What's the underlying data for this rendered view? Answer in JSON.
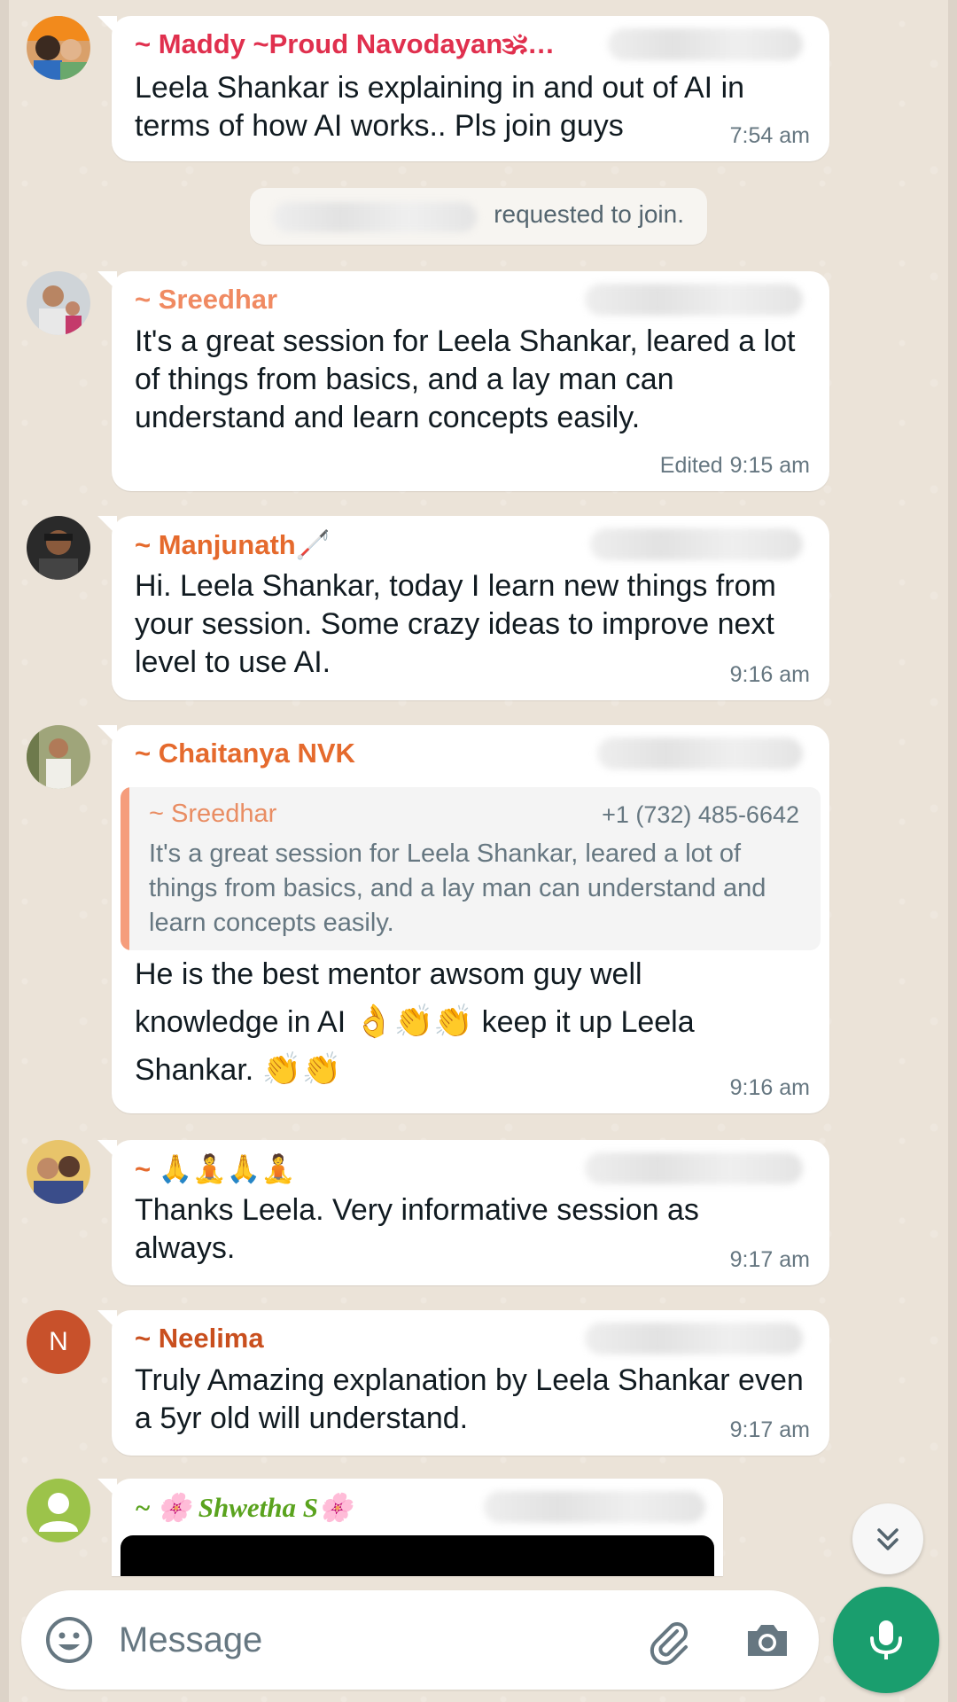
{
  "messages": [
    {
      "sender": "~ Maddy ~Proud Navodayan🕉…",
      "sender_color": "#e0304e",
      "text": "Leela Shankar is explaining in and out of AI in terms of how AI works.. Pls join guys",
      "time": "7:54 am"
    },
    {
      "sender": "~ Sreedhar",
      "sender_color": "#f08a62",
      "text": "It's a great session for Leela Shankar, leared a lot of things from basics, and a lay man can understand and learn concepts easily.",
      "edited": "Edited",
      "time": "9:15 am"
    },
    {
      "sender": "~ Manjunath🦯",
      "sender_color": "#e56a2d",
      "text": "Hi. Leela Shankar, today I learn new things from your session. Some crazy ideas to improve next level to use AI.",
      "time": "9:16 am"
    },
    {
      "sender": "~ Chaitanya NVK",
      "sender_color": "#e56a2d",
      "quote": {
        "sender": "~ Sreedhar",
        "phone": "+1 (732) 485-6642",
        "text": "It's a great session for Leela Shankar, leared a lot of things from basics, and a lay man can understand and learn concepts easily."
      },
      "text_line1": "He is the best mentor awsom guy well",
      "text_line2_a": "knowledge in AI",
      "text_line2_emoji": "👌👏👏",
      "text_line2_b": "keep it up Leela",
      "text_line3_a": "Shankar.",
      "text_line3_emoji": "👏👏",
      "time": "9:16 am"
    },
    {
      "sender": "~ 🙏🧘🙏🧘",
      "sender_color": "#e56a2d",
      "text": "Thanks Leela. Very informative session as always.",
      "time": "9:17 am"
    },
    {
      "sender": "~ Neelima",
      "sender_color": "#c94f1e",
      "avatar_letter": "N",
      "avatar_color": "#c8512b",
      "text": "Truly Amazing explanation by Leela Shankar even a 5yr old will understand.",
      "time": "9:17 am"
    },
    {
      "sender": "~ 🌸 Shwetha S🌸",
      "sender_color": "#5aa31e"
    }
  ],
  "system_message": "requested to join.",
  "input": {
    "placeholder": "Message"
  },
  "icons": {
    "emoji": "emoji-icon",
    "attach": "paperclip-icon",
    "camera": "camera-icon",
    "mic": "microphone-icon",
    "scroll": "double-chevron-down-icon"
  },
  "colors": {
    "accent": "#1a9e6e",
    "bubble": "#ffffff",
    "wallpaper": "#ebe3d8"
  }
}
